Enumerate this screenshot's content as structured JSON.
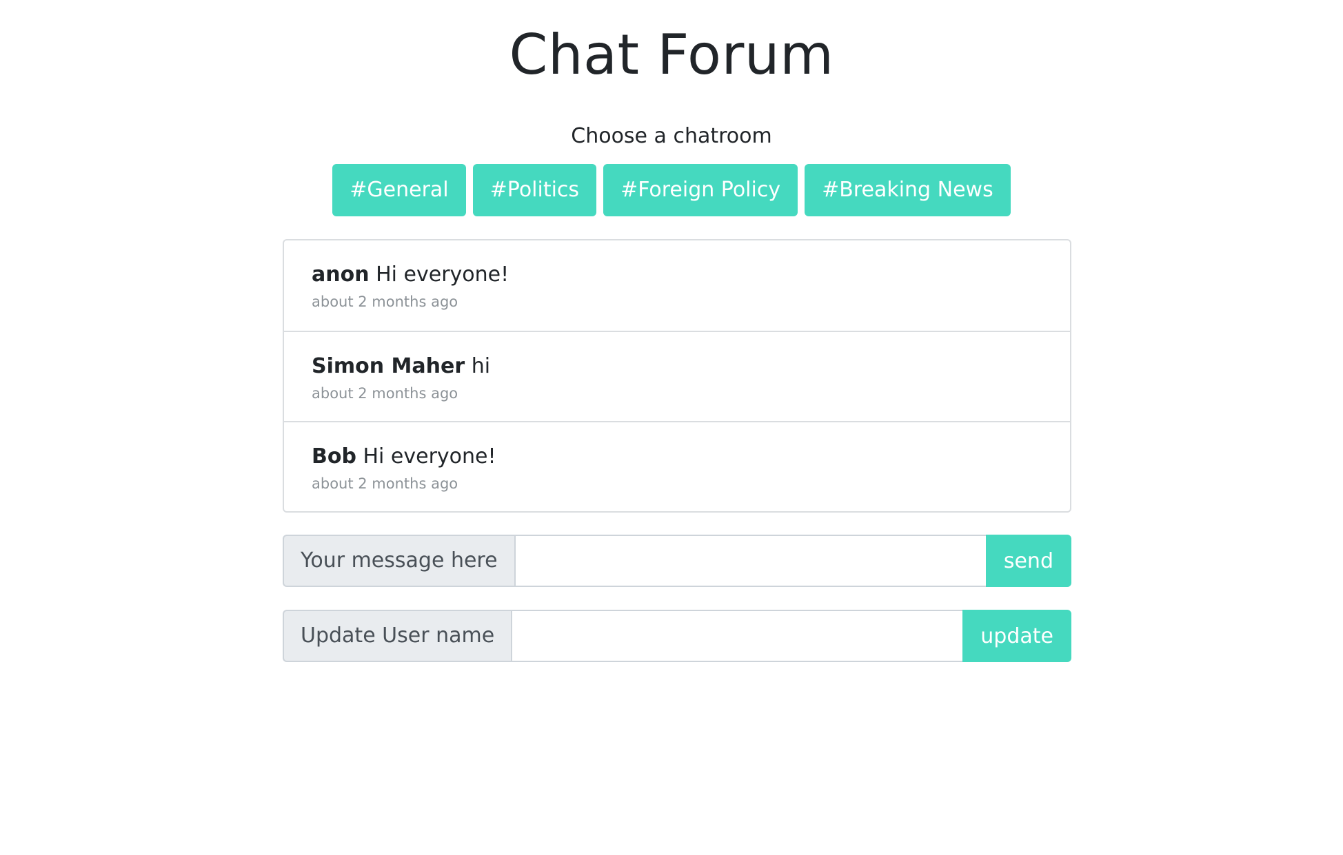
{
  "header": {
    "title": "Chat Forum",
    "subtitle": "Choose a chatroom"
  },
  "chatrooms": [
    {
      "label": "#General"
    },
    {
      "label": "#Politics"
    },
    {
      "label": "#Foreign Policy"
    },
    {
      "label": "#Breaking News"
    }
  ],
  "messages": [
    {
      "user": "anon",
      "text": "Hi everyone!",
      "time": "about 2 months ago"
    },
    {
      "user": "Simon Maher",
      "text": "hi",
      "time": "about 2 months ago"
    },
    {
      "user": "Bob",
      "text": "Hi everyone!",
      "time": "about 2 months ago"
    }
  ],
  "message_form": {
    "label": "Your message here",
    "value": "",
    "button": "send"
  },
  "username_form": {
    "label": "Update User name",
    "value": "",
    "button": "update"
  },
  "colors": {
    "accent": "#45d9bf",
    "label_bg": "#e9ecef",
    "border": "#dadde0",
    "muted_text": "#8c9297"
  }
}
